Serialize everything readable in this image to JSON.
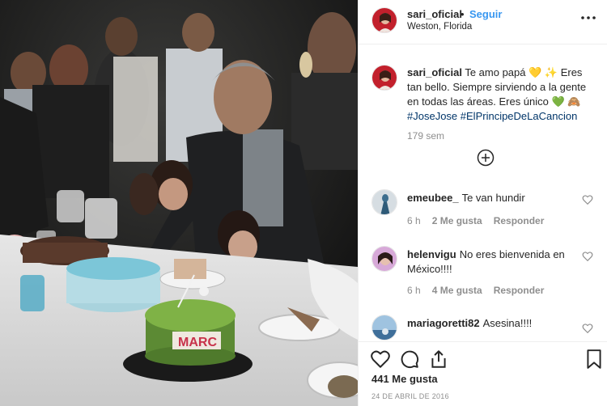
{
  "photo": {
    "cake_lettering": "MARC"
  },
  "header": {
    "username": "sari_oficial",
    "separator": "•",
    "follow_label": "Seguir",
    "location": "Weston, Florida",
    "avatar_icon": "profile-avatar",
    "more_icon": "more-options-icon"
  },
  "caption": {
    "username": "sari_oficial",
    "text": "Te amo papá 💛 ✨ Eres tan bello. Siempre sirviendo a la gente en todas las áreas. Eres único 💚 🙈",
    "hashtags": [
      "#JoseJose",
      "#ElPrincipeDeLaCancion"
    ],
    "time": "179 sem"
  },
  "load_more_icon": "plus-circle-icon",
  "comments": [
    {
      "username": "emeubee_",
      "text": "Te van hundir",
      "time": "6 h",
      "likes": "2 Me gusta",
      "reply": "Responder"
    },
    {
      "username": "helenvigu",
      "text": "No eres bienvenida en México!!!!",
      "time": "6 h",
      "likes": "4 Me gusta",
      "reply": "Responder"
    },
    {
      "username": "mariagoretti82",
      "text": "Asesina!!!!"
    }
  ],
  "actions": {
    "likes": "441 Me gusta",
    "date": "24 DE ABRIL DE 2016",
    "icons": [
      "heart-icon",
      "comment-icon",
      "share-icon",
      "bookmark-icon"
    ]
  },
  "colors": {
    "link": "#3897f0",
    "hashtag": "#003569",
    "muted": "#8e8e8e",
    "text": "#262626"
  }
}
